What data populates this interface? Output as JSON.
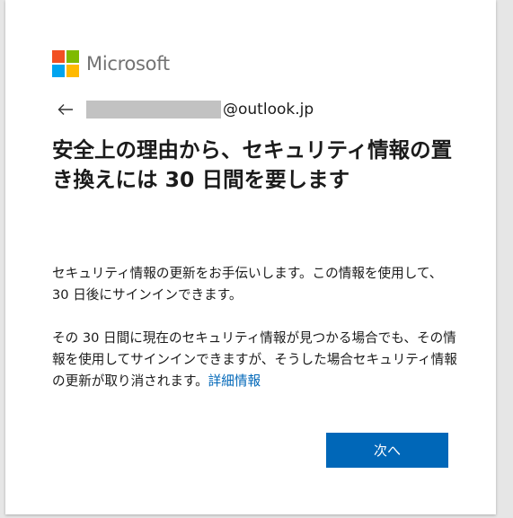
{
  "brand": {
    "name": "Microsoft",
    "logo_colors": [
      "#f25022",
      "#7fba00",
      "#00a4ef",
      "#ffb900"
    ]
  },
  "identity": {
    "back_icon": "arrow-left-icon",
    "email_domain": "@outlook.jp"
  },
  "title": "安全上の理由から、セキュリティ情報の置き換えには 30 日間を要します",
  "paragraph1": "セキュリティ情報の更新をお手伝いします。この情報を使用して、30 日後にサインインできます。",
  "paragraph2": "その 30 日間に現在のセキュリティ情報が見つかる場合でも、その情報を使用してサインインできますが、そうした場合セキュリティ情報の更新が取り消されます。",
  "details_link": "詳細情報",
  "next_button": "次へ",
  "colors": {
    "accent": "#0067b8",
    "text": "#1b1b1b",
    "brand_gray": "#737373"
  }
}
